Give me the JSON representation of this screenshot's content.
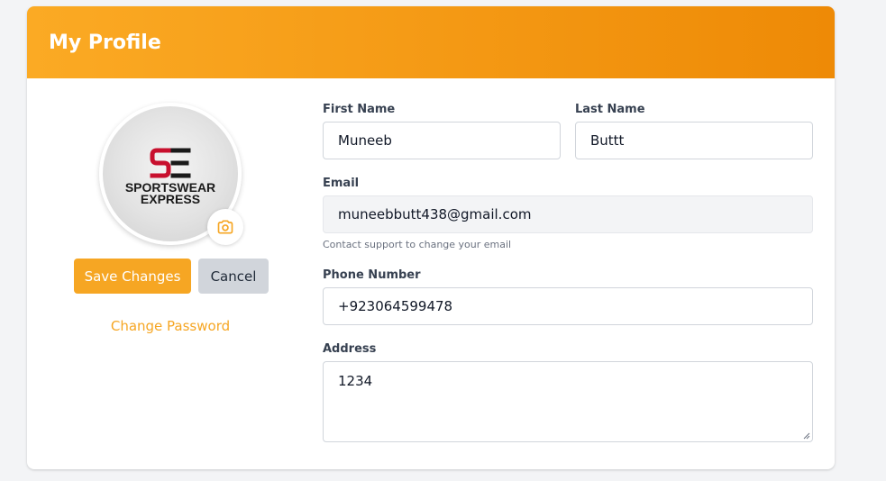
{
  "header": {
    "title": "My Profile"
  },
  "profile": {
    "logo_top": "SE",
    "logo_line1": "SPORTSWEAR",
    "logo_line2": "EXPRESS",
    "camera_icon": "camera-icon"
  },
  "actions": {
    "save_label": "Save Changes",
    "cancel_label": "Cancel",
    "change_password_label": "Change Password"
  },
  "form": {
    "first_name": {
      "label": "First Name",
      "value": "Muneeb"
    },
    "last_name": {
      "label": "Last Name",
      "value": "Buttt"
    },
    "email": {
      "label": "Email",
      "value": "muneebbutt438@gmail.com",
      "help": "Contact support to change your email"
    },
    "phone": {
      "label": "Phone Number",
      "value": "+923064599478"
    },
    "address": {
      "label": "Address",
      "value": "1234"
    }
  },
  "colors": {
    "accent": "#f6a623",
    "header_start": "#fbaa24",
    "header_end": "#ee8a06",
    "logo_red": "#c8102e"
  }
}
